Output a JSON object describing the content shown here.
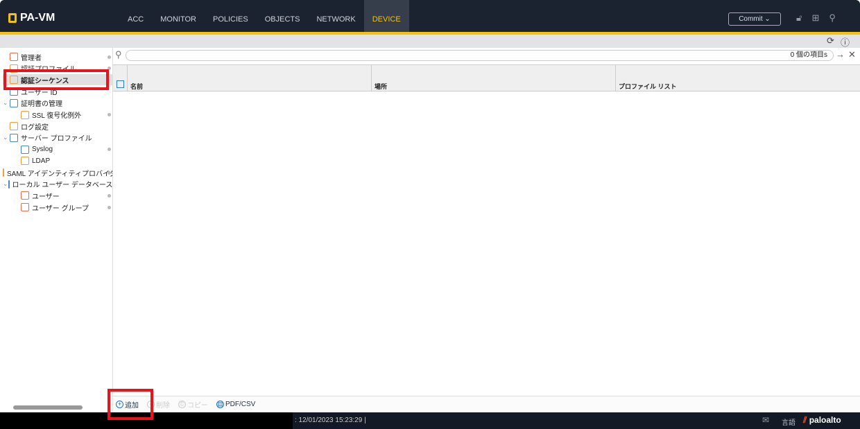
{
  "header": {
    "logo": "PA-VM",
    "tabs": [
      "ACC",
      "MONITOR",
      "POLICIES",
      "OBJECTS",
      "NETWORK",
      "DEVICE"
    ],
    "active_tab": "DEVICE",
    "commit_label": "Commit ⌄"
  },
  "sidebar": {
    "items": [
      {
        "label": "管理者",
        "level": 0
      },
      {
        "label": "認証プロファイル",
        "level": 0
      },
      {
        "label": "認証シーケンス",
        "level": 0,
        "selected": true
      },
      {
        "label": "ユーザー ID",
        "level": 0
      },
      {
        "label": "証明書の管理",
        "level": 0,
        "expanded": true
      },
      {
        "label": "SSL 復号化例外",
        "level": 1
      },
      {
        "label": "ログ設定",
        "level": 0
      },
      {
        "label": "サーバー プロファイル",
        "level": 0,
        "expanded": true
      },
      {
        "label": "Syslog",
        "level": 1
      },
      {
        "label": "LDAP",
        "level": 1
      },
      {
        "label": "SAML アイデンティティプロバイダ",
        "level": 1
      },
      {
        "label": "ローカル ユーザー データベース",
        "level": 0,
        "expanded": true
      },
      {
        "label": "ユーザー",
        "level": 1
      },
      {
        "label": "ユーザー グループ",
        "level": 1
      }
    ]
  },
  "search": {
    "count": "0 個の項目s"
  },
  "table": {
    "columns": [
      "名前",
      "場所",
      "プロファイル リスト"
    ]
  },
  "toolbar": {
    "add": "追加",
    "delete": "削除",
    "copy": "コピー",
    "pdf": "PDF/CSV"
  },
  "status": {
    "time": ":  12/01/2023 15:23:29 |",
    "language": "言語",
    "brand": "paloalto"
  },
  "colors": {
    "accent": "#f4c20d",
    "highlight": "#e8141c"
  }
}
